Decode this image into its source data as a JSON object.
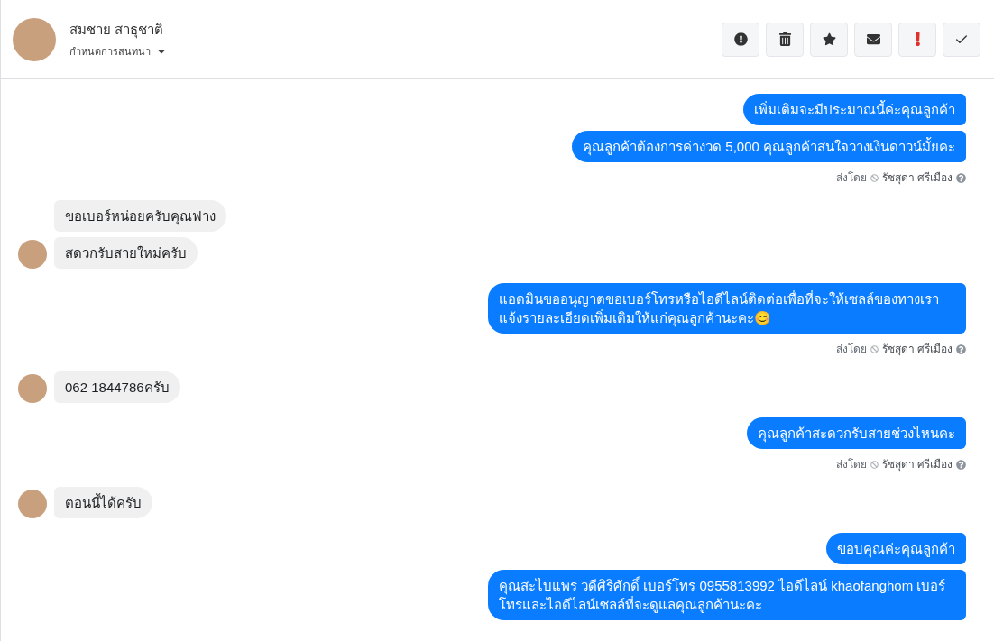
{
  "header": {
    "name": "สมชาย สาธุชาติ",
    "assign_label": "กำหนดการสนทนา"
  },
  "messages": [
    {
      "kind": "out",
      "text": "เพิ่มเติมจะมีประมาณนี้ค่ะคุณลูกค้า"
    },
    {
      "kind": "out",
      "text": "คุณลูกค้าต้องการค่างวด 5,000  คุณลูกค้าสนใจวางเงินดาวน์มั้ยคะ"
    },
    {
      "kind": "meta",
      "label": "ส่งโดย",
      "agent": "รัชสุดา ศรีเมือง"
    },
    {
      "kind": "in",
      "text": "ขอเบอร์หน่อยครับคุณฟาง",
      "avatar": false
    },
    {
      "kind": "in",
      "text": "สดวกรับสายใหม่ครับ",
      "avatar": true
    },
    {
      "kind": "out",
      "text": "แอดมินขออนุญาตขอเบอร์โทรหรือไอดีไลน์ติดต่อเพื่อที่จะให้เซลล์ของทางเราแจ้งรายละเอียดเพิ่มเติมให้แก่คุณลูกค้านะคะ😊"
    },
    {
      "kind": "meta",
      "label": "ส่งโดย",
      "agent": "รัชสุดา ศรีเมือง"
    },
    {
      "kind": "in",
      "text": "062 1844786ครับ",
      "avatar": true
    },
    {
      "kind": "out",
      "text": "คุณลูกค้าสะดวกรับสายช่วงไหนคะ"
    },
    {
      "kind": "meta",
      "label": "ส่งโดย",
      "agent": "รัชสุดา ศรีเมือง"
    },
    {
      "kind": "in",
      "text": "ตอนนี้ได้ครับ",
      "avatar": true
    },
    {
      "kind": "out",
      "text": "ขอบคุณค่ะคุณลูกค้า"
    },
    {
      "kind": "out",
      "text": "คุณสะไบแพร วดีศิริศักดิ์ เบอร์โทร 0955813992  ไอดีไลน์  khaofanghom   เบอร์โทรและไอดีไลน์เซลล์ที่จะดูแลคุณลูกค้านะคะ"
    }
  ]
}
